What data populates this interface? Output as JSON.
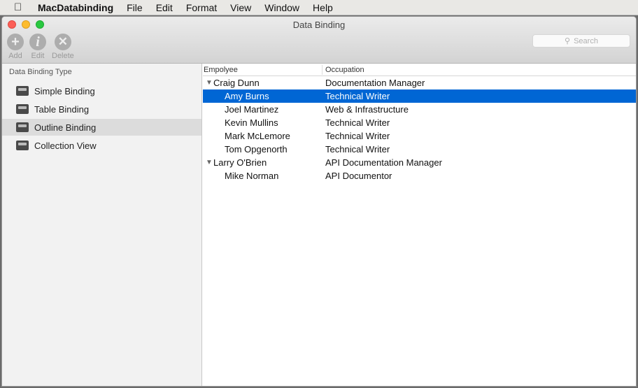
{
  "menubar": {
    "app": "MacDatabinding",
    "items": [
      "File",
      "Edit",
      "Format",
      "View",
      "Window",
      "Help"
    ]
  },
  "window": {
    "title": "Data Binding"
  },
  "toolbar": {
    "add": "Add",
    "edit": "Edit",
    "delete": "Delete",
    "search_placeholder": "Search"
  },
  "sidebar": {
    "header": "Data Binding Type",
    "items": [
      {
        "label": "Simple Binding"
      },
      {
        "label": "Table Binding"
      },
      {
        "label": "Outline Binding",
        "selected": true
      },
      {
        "label": "Collection View"
      }
    ]
  },
  "outline": {
    "columns": [
      "Empolyee",
      "Occupation"
    ],
    "rows": [
      {
        "name": "Craig Dunn",
        "occupation": "Documentation Manager",
        "level": 0
      },
      {
        "name": "Amy Burns",
        "occupation": "Technical Writer",
        "level": 1,
        "selected": true
      },
      {
        "name": "Joel Martinez",
        "occupation": "Web & Infrastructure",
        "level": 1
      },
      {
        "name": "Kevin Mullins",
        "occupation": "Technical Writer",
        "level": 1
      },
      {
        "name": "Mark McLemore",
        "occupation": "Technical Writer",
        "level": 1
      },
      {
        "name": "Tom Opgenorth",
        "occupation": "Technical Writer",
        "level": 1
      },
      {
        "name": "Larry O'Brien",
        "occupation": "API Documentation Manager",
        "level": 0
      },
      {
        "name": "Mike Norman",
        "occupation": "API Documentor",
        "level": 1
      }
    ]
  }
}
